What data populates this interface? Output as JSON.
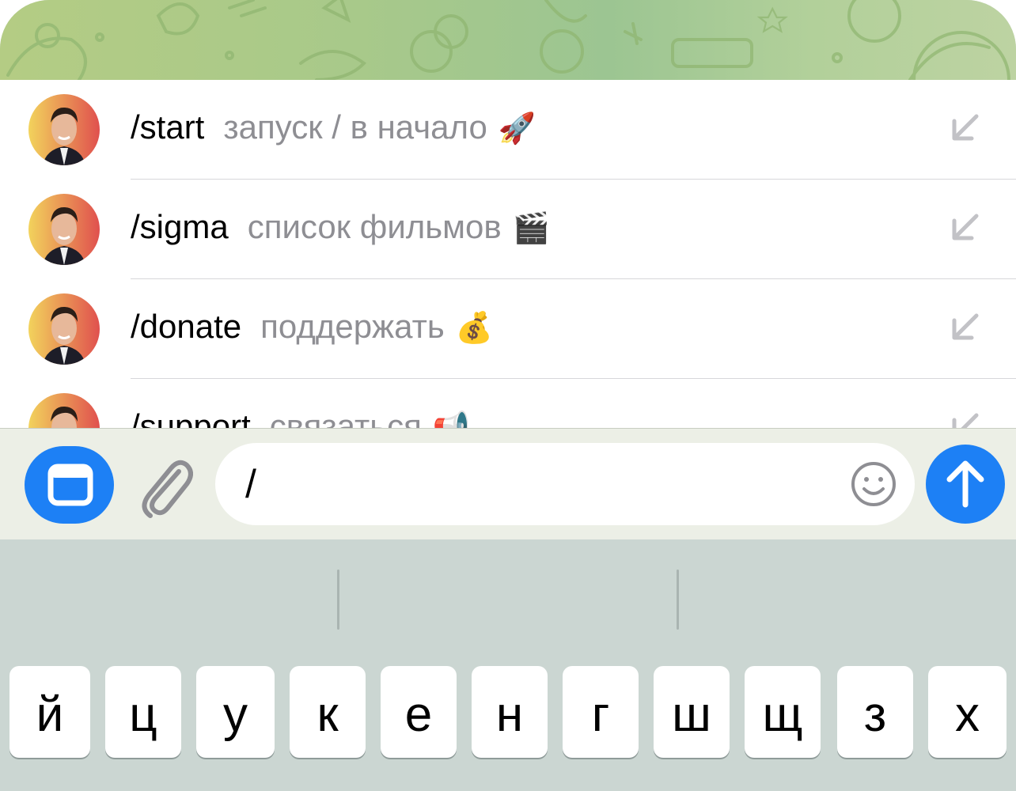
{
  "commands": [
    {
      "name": "/start",
      "description": "запуск / в начало",
      "emoji": "🚀",
      "emoji_icon": "rocket-icon"
    },
    {
      "name": "/sigma",
      "description": "список фильмов",
      "emoji": "🎬",
      "emoji_icon": "clapper-board-icon"
    },
    {
      "name": "/donate",
      "description": "поддержать",
      "emoji": "💰",
      "emoji_icon": "money-bag-icon"
    },
    {
      "name": "/support",
      "description": "связаться",
      "emoji": "📢",
      "emoji_icon": "megaphone-icon"
    }
  ],
  "input": {
    "value": "/",
    "menu_icon": "bot-menu-icon",
    "attach_icon": "paperclip-icon",
    "emoji_icon": "smiley-icon",
    "send_icon": "arrow-up-icon"
  },
  "keyboard": {
    "row1": [
      "й",
      "ц",
      "у",
      "к",
      "е",
      "н",
      "г",
      "ш",
      "щ",
      "з",
      "х"
    ]
  },
  "colors": {
    "accent": "#1d80f5",
    "wallpaper": "#a8c98a",
    "keyboard_bg": "#cbd6d2",
    "secondary_text": "#8e8e93"
  }
}
